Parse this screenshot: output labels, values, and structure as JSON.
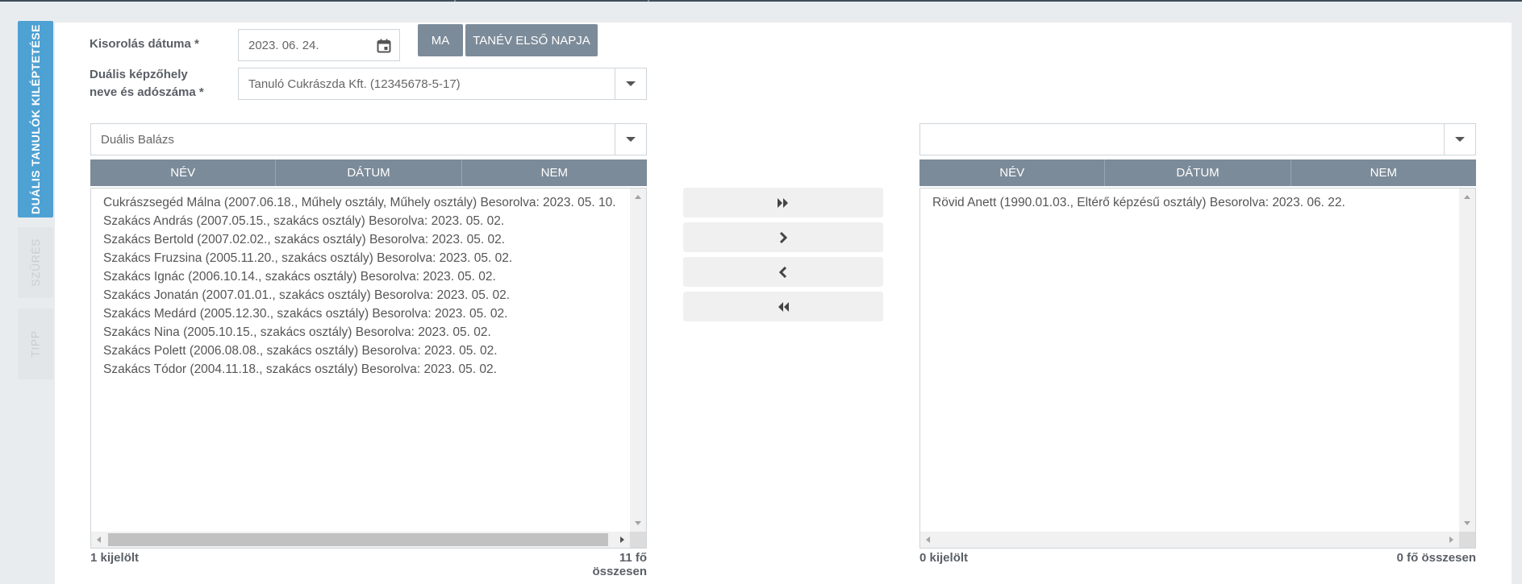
{
  "side_tabs": [
    {
      "label": "DUÁLIS TANULÓK KILÉPTETÉSE"
    },
    {
      "label": "SZŰRÉS"
    },
    {
      "label": "TIPP"
    }
  ],
  "form": {
    "date_label": "Kisorolás dátuma *",
    "date_value": "2023. 06. 24.",
    "btn_today": "MA",
    "btn_first_day": "TANÉV ELSŐ NAPJA",
    "place_label_1": "Duális képzőhely",
    "place_label_2": "neve és adószáma *",
    "place_value": "Tanuló Cukrászda Kft. (12345678-5-17)"
  },
  "left": {
    "filter_value": "Duális Balázs",
    "columns": [
      "NÉV",
      "DÁTUM",
      "NEM"
    ],
    "rows": [
      "Cukrászsegéd Málna (2007.06.18., Műhely osztály, Műhely osztály) Besorolva: 2023. 05. 10.",
      "Szakács András (2007.05.15., szakács osztály) Besorolva: 2023. 05. 02.",
      "Szakács Bertold (2007.02.02., szakács osztály) Besorolva: 2023. 05. 02.",
      "Szakács Fruzsina (2005.11.20., szakács osztály) Besorolva: 2023. 05. 02.",
      "Szakács Ignác (2006.10.14., szakács osztály) Besorolva: 2023. 05. 02.",
      "Szakács Jonatán (2007.01.01., szakács osztály) Besorolva: 2023. 05. 02.",
      "Szakács Medárd (2005.12.30., szakács osztály) Besorolva: 2023. 05. 02.",
      "Szakács Nina (2005.10.15., szakács osztály) Besorolva: 2023. 05. 02.",
      "Szakács Polett (2006.08.08., szakács osztály) Besorolva: 2023. 05. 02.",
      "Szakács Tódor (2004.11.18., szakács osztály) Besorolva: 2023. 05. 02."
    ],
    "selected_count": "1 kijelölt",
    "total_count": "11 fő összesen"
  },
  "right": {
    "filter_value": "",
    "columns": [
      "NÉV",
      "DÁTUM",
      "NEM"
    ],
    "rows": [
      "Rövid Anett (1990.01.03., Eltérő képzésű osztály) Besorolva: 2023. 06. 22."
    ],
    "selected_count": "0 kijelölt",
    "total_count": "0 fő összesen"
  },
  "move_buttons": {
    "all_right": "»",
    "one_right": "›",
    "one_left": "‹",
    "all_left": "«"
  },
  "icons": [
    "calendar-icon",
    "chevron-down-icon",
    "double-chevron-right-icon",
    "chevron-right-icon",
    "chevron-left-icon",
    "double-chevron-left-icon"
  ]
}
